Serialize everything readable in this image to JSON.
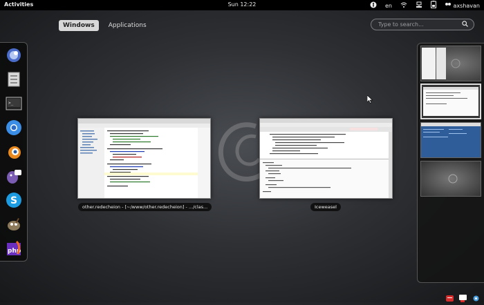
{
  "topbar": {
    "activities": "Activities",
    "clock": "Sun 12:22",
    "lang": "en",
    "user": "axshavan"
  },
  "view_selector": {
    "windows": "Windows",
    "applications": "Applications"
  },
  "search": {
    "placeholder": "Type to search..."
  },
  "dash": {
    "apps": [
      "empathy-icon",
      "files-icon",
      "terminal-icon",
      "chromium-icon",
      "blender-icon",
      "pidgin-icon",
      "skype-icon",
      "gimp-icon",
      "php-storm-icon"
    ]
  },
  "windows": [
    {
      "caption": "other.redecheion - [~/www/other.redecheion] - .../clas..."
    },
    {
      "caption": "Iceweasel"
    }
  ],
  "workspaces_count": 4,
  "colors": {
    "topbar": "#000000",
    "accent_red": "#d62b2b",
    "ws_blue": "#2e5d9a"
  }
}
